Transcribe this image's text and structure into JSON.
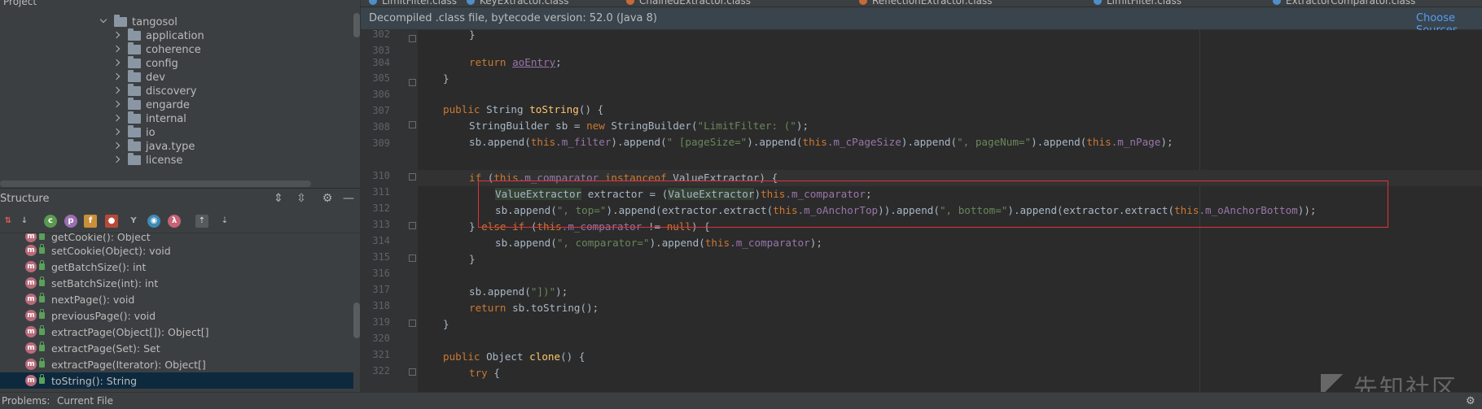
{
  "project": {
    "header_label": "Project",
    "root": "tangosol",
    "folders": [
      "application",
      "coherence",
      "config",
      "dev",
      "discovery",
      "engarde",
      "internal",
      "io",
      "java.type",
      "license"
    ]
  },
  "structure": {
    "title": "Structure",
    "members": [
      "getCookie(): Object",
      "setCookie(Object): void",
      "getBatchSize(): int",
      "setBatchSize(int): int",
      "nextPage(): void",
      "previousPage(): void",
      "extractPage(Object[]): Object[]",
      "extractPage(Set): Set",
      "extractPage(Iterator): Object[]",
      "toString(): String"
    ],
    "selected_index": 9,
    "method_badge": "m",
    "toolbar_badges": [
      "c",
      "p",
      "f",
      "◉",
      "λ"
    ]
  },
  "bottom": {
    "problems": "Problems:",
    "current_file": "Current File"
  },
  "tabs": [
    {
      "label": "LimitFilter.class"
    },
    {
      "label": "KeyExtractor.class"
    },
    {
      "label": "ChainedExtractor.class"
    },
    {
      "label": "ReflectionExtractor.class"
    },
    {
      "label": "LimitFilter.class"
    },
    {
      "label": "ExtractorComparator.class"
    }
  ],
  "banner": {
    "message": "Decompiled .class file, bytecode version: 52.0 (Java 8)",
    "link": "Choose Sources..."
  },
  "line_numbers": [
    "302",
    "303",
    "304",
    "305",
    "306",
    "307",
    "308",
    "309",
    "310",
    "311",
    "312",
    "313",
    "314",
    "315",
    "316",
    "317",
    "318",
    "319",
    "320",
    "321",
    "322"
  ],
  "code": {
    "l302": "}",
    "l304_kw": "return",
    "l304_var": "aoEntry",
    "l307_kw": "public",
    "l307_type": "String",
    "l307_name": "toString",
    "l307_rest": "() {",
    "l308_a": "StringBuilder sb = ",
    "l308_kw": "new",
    "l308_b": " StringBuilder(",
    "l308_str": "\"LimitFilter: (\"",
    "l308_c": ");",
    "l309_a": "sb.append(",
    "l309_this1": "this",
    "l309_f1": ".m_filter",
    "l309_b": ").append(",
    "l309_s1": "\" [pageSize=\"",
    "l309_c": ").append(",
    "l309_this2": "this",
    "l309_f2": ".m_cPageSize",
    "l309_d": ").append(",
    "l309_s2": "\", pageNum=\"",
    "l309_e": ").append(",
    "l309_this3": "this",
    "l309_f3": ".m_nPage",
    "l309_f": ");",
    "l310_if": "if",
    "l310_a": " (",
    "l310_this": "this",
    "l310_f": ".m_comparator",
    "l310_inst": " instanceof",
    "l310_b": " ValueExtractor) {",
    "l311_hl": "ValueExtractor",
    "l311_a": " extractor = (",
    "l311_hl2": "ValueExtractor",
    "l311_b": ")",
    "l311_this": "this",
    "l311_f": ".m_comparator",
    "l311_c": ";",
    "l312_a": "sb.append(",
    "l312_s1": "\", top=\"",
    "l312_b": ").append(extractor.extract(",
    "l312_this1": "this",
    "l312_f1": ".m_oAnchorTop",
    "l312_c": ")).append(",
    "l312_s2": "\", bottom=\"",
    "l312_d": ").append(extractor.extract(",
    "l312_this2": "this",
    "l312_f2": ".m_oAnchorBottom",
    "l312_e": "));",
    "l313_a": "} ",
    "l313_else": "else if",
    "l313_b": " (",
    "l313_this": "this",
    "l313_f": ".m_comparator",
    "l313_c": " != ",
    "l313_null": "null",
    "l313_d": ") {",
    "l314_a": "sb.append(",
    "l314_s": "\", comparator=\"",
    "l314_b": ").append(",
    "l314_this": "this",
    "l314_f": ".m_comparator",
    "l314_c": ");",
    "l315": "}",
    "l317_a": "sb.append(",
    "l317_s": "\"])\"",
    "l317_b": ");",
    "l318_kw": "return",
    "l318_a": " sb.toString();",
    "l319": "}",
    "l321_kw": "public",
    "l321_type": " Object ",
    "l321_name": "clone",
    "l321_rest": "() {",
    "l322_kw": "try",
    "l322_a": " {"
  },
  "watermark": "先知社区",
  "colors": {
    "keyword": "#cc7832",
    "string": "#6a8759",
    "field": "#9876aa",
    "method": "#ffc66d",
    "highlight_box": "#e0323c"
  }
}
